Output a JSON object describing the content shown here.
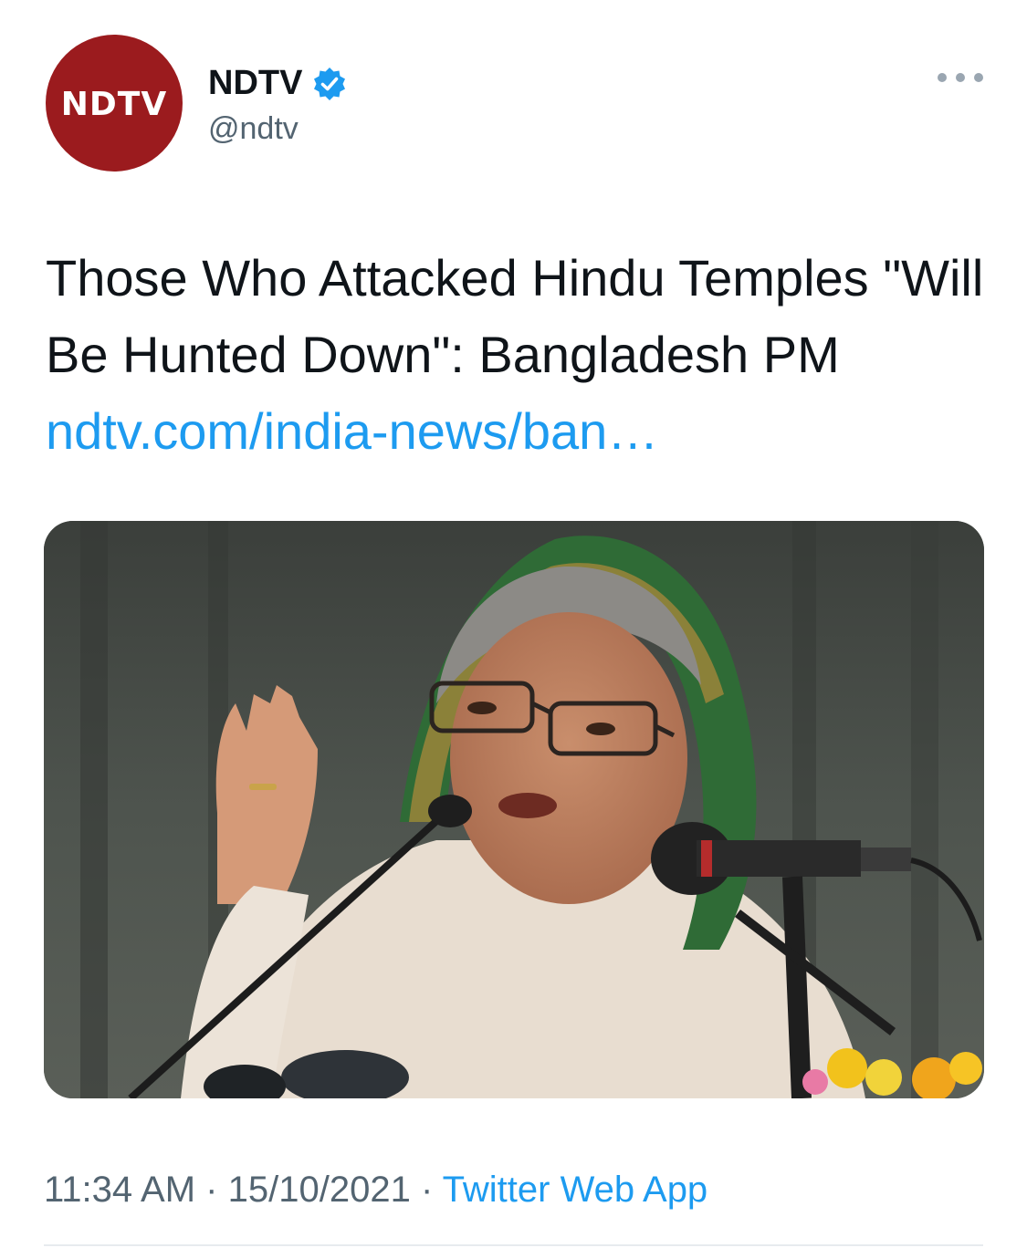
{
  "author": {
    "display_name": "NDTV",
    "handle": "@ndtv",
    "avatar_text": "NDTV",
    "verified": true,
    "avatar_color": "#9b1b1e"
  },
  "tweet": {
    "text": "Those Who Attacked Hindu Temples \"Will Be Hunted Down\": Bangladesh PM",
    "link_text": "ndtv.com/india-news/ban…"
  },
  "meta": {
    "time": "11:34 AM",
    "separator": "·",
    "date": "15/10/2021",
    "source": "Twitter Web App"
  },
  "icons": {
    "verified": "verified-badge-icon",
    "more": "more-options-icon"
  },
  "colors": {
    "link": "#1d9bf0",
    "secondary_text": "#536471",
    "verified": "#1d9bf0"
  }
}
